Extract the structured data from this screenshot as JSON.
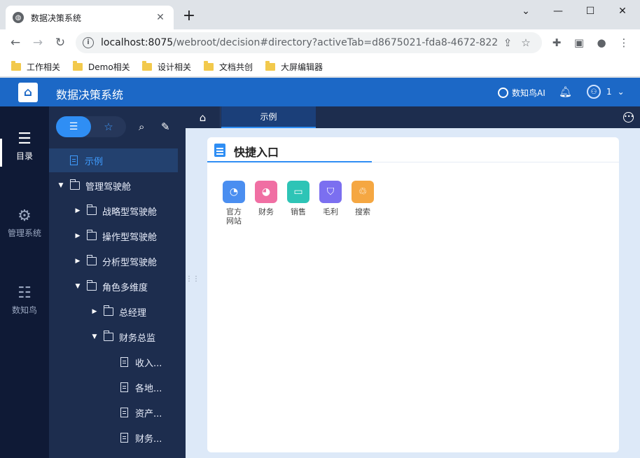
{
  "browser": {
    "tab_title": "数据决策系统",
    "new_tab": "+",
    "close": "✕",
    "url_host": "localhost:8075",
    "url_path": "/webroot/decision#directory?activeTab=d8675021-fda8-4672-8229...",
    "bookmarks": [
      "工作相关",
      "Demo相关",
      "设计相关",
      "文档共创",
      "大屏编辑器"
    ]
  },
  "app": {
    "title": "数据决策系统",
    "ai_label": "数知鸟AI",
    "user_label": "1"
  },
  "rail": [
    {
      "label": "目录",
      "icon": "list-icon"
    },
    {
      "label": "管理系统",
      "icon": "gear-icon"
    },
    {
      "label": "数知鸟",
      "icon": "grid-icon"
    }
  ],
  "tree": [
    {
      "label": "示例",
      "level": 0,
      "type": "doc",
      "selected": true
    },
    {
      "label": "管理驾驶舱",
      "level": 0,
      "type": "folder",
      "expanded": true
    },
    {
      "label": "战略型驾驶舱",
      "level": 1,
      "type": "folder",
      "expanded": false
    },
    {
      "label": "操作型驾驶舱",
      "level": 1,
      "type": "folder",
      "expanded": false
    },
    {
      "label": "分析型驾驶舱",
      "level": 1,
      "type": "folder",
      "expanded": false
    },
    {
      "label": "角色多维度",
      "level": 1,
      "type": "folder",
      "expanded": true
    },
    {
      "label": "总经理",
      "level": 2,
      "type": "folder",
      "expanded": false
    },
    {
      "label": "财务总监",
      "level": 2,
      "type": "folder",
      "expanded": true
    },
    {
      "label": "收入...",
      "level": 3,
      "type": "doc"
    },
    {
      "label": "各地...",
      "level": 3,
      "type": "doc"
    },
    {
      "label": "资产...",
      "level": 3,
      "type": "doc"
    },
    {
      "label": "财务...",
      "level": 3,
      "type": "doc"
    }
  ],
  "content": {
    "tab_label": "示例",
    "card_title": "快捷入口",
    "shortcuts": [
      {
        "label": "官方网站",
        "color": "#4a8ef0",
        "icon": "compass-icon"
      },
      {
        "label": "财务",
        "color": "#f06fa3",
        "icon": "pie-icon"
      },
      {
        "label": "销售",
        "color": "#2ec4b6",
        "icon": "card-icon"
      },
      {
        "label": "毛利",
        "color": "#7b6ff0",
        "icon": "shield-icon"
      },
      {
        "label": "搜索",
        "color": "#f5a742",
        "icon": "cycle-icon"
      }
    ]
  }
}
